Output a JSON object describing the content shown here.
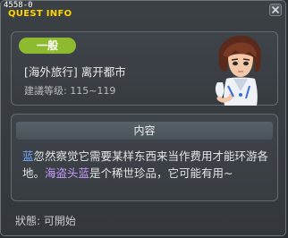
{
  "window": {
    "id_label": "4558-0",
    "title": "QUEST INFO"
  },
  "quest": {
    "category_badge": "一般",
    "title": "[海外旅行] 离开都市",
    "level_label": "建議等级",
    "level_range": "115~119"
  },
  "content": {
    "header": "内容",
    "desc_part1": "蓝",
    "desc_part2": "忽然察觉它需要某样东西来当作费用才能环游各地。",
    "desc_part3": "海盗头蓝",
    "desc_part4": "是个稀世珍品，它可能有用~"
  },
  "status": {
    "label": "狀態",
    "value": "可開始"
  },
  "colors": {
    "title_yellow": "#ffd400",
    "badge_green": "#8dba2e",
    "highlight_blue": "#6fa8ff",
    "highlight_purple": "#c89bff"
  },
  "icons": {
    "close": "close-icon",
    "portrait": "npc-portrait"
  }
}
